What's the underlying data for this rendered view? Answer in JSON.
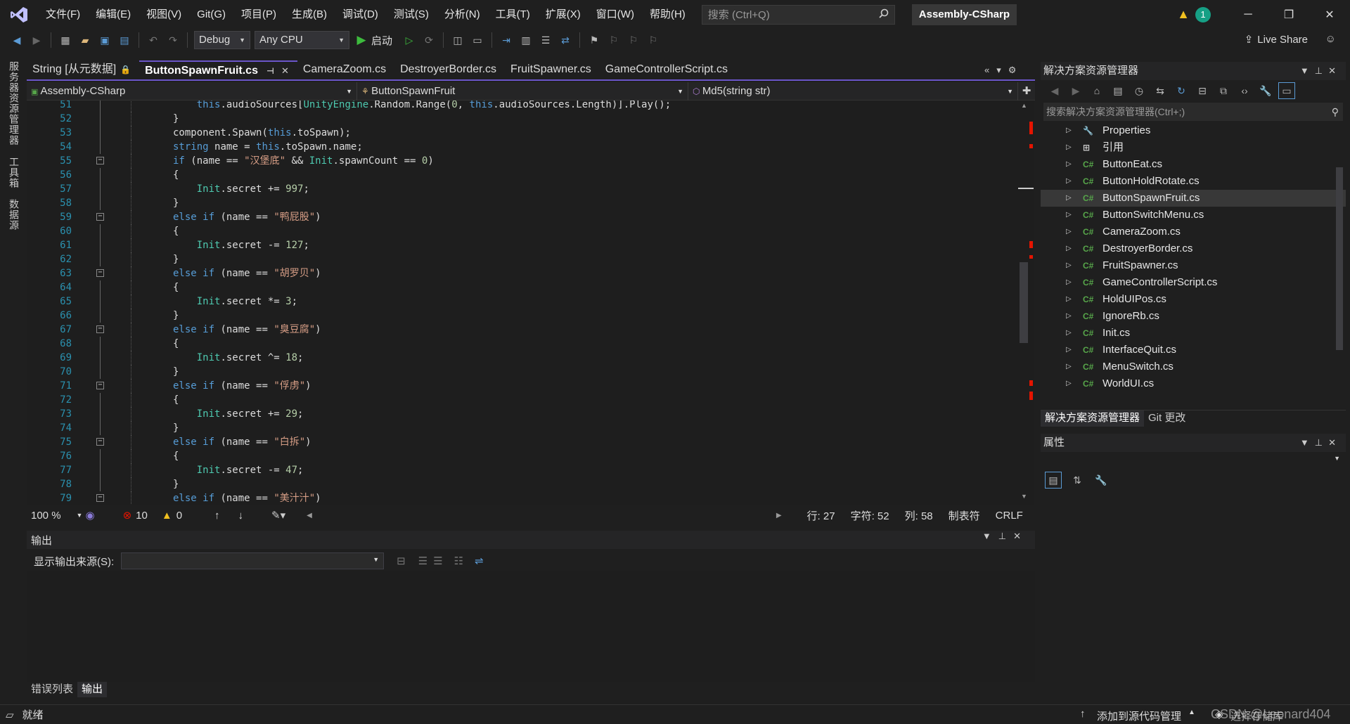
{
  "titlebar": {
    "menus": [
      "文件(F)",
      "编辑(E)",
      "视图(V)",
      "Git(G)",
      "项目(P)",
      "生成(B)",
      "调试(D)",
      "测试(S)",
      "分析(N)",
      "工具(T)",
      "扩展(X)",
      "窗口(W)",
      "帮助(H)"
    ],
    "search_placeholder": "搜索 (Ctrl+Q)",
    "solution_name": "Assembly-CSharp",
    "notification_count": "1"
  },
  "toolbar": {
    "config": "Debug",
    "platform": "Any CPU",
    "start_label": "启动",
    "live_share": "Live Share"
  },
  "left_strip": [
    "服务器资源管理器",
    "工具箱",
    "数据源"
  ],
  "editor": {
    "tabs": [
      {
        "label": "String [从元数据]",
        "active": false
      },
      {
        "label": "ButtonSpawnFruit.cs",
        "active": true
      },
      {
        "label": "CameraZoom.cs",
        "active": false
      },
      {
        "label": "DestroyerBorder.cs",
        "active": false
      },
      {
        "label": "FruitSpawner.cs",
        "active": false
      },
      {
        "label": "GameControllerScript.cs",
        "active": false
      }
    ],
    "nav_project": "Assembly-CSharp",
    "nav_class": "ButtonSpawnFruit",
    "nav_member": "Md5(string str)",
    "lines": [
      {
        "n": "51",
        "code": "    this.audioSources[UnityEngine.Random.Range(0, this.audioSources.Length)].Play();"
      },
      {
        "n": "52",
        "code": "}"
      },
      {
        "n": "53",
        "code": "component.Spawn(this.toSpawn);"
      },
      {
        "n": "54",
        "code": "string name = this.toSpawn.name;"
      },
      {
        "n": "55",
        "code": "if (name == \"汉堡底\" && Init.spawnCount == 0)"
      },
      {
        "n": "56",
        "code": "{"
      },
      {
        "n": "57",
        "code": "    Init.secret += 997;"
      },
      {
        "n": "58",
        "code": "}"
      },
      {
        "n": "59",
        "code": "else if (name == \"鸭屁股\")"
      },
      {
        "n": "60",
        "code": "{"
      },
      {
        "n": "61",
        "code": "    Init.secret -= 127;"
      },
      {
        "n": "62",
        "code": "}"
      },
      {
        "n": "63",
        "code": "else if (name == \"胡罗贝\")"
      },
      {
        "n": "64",
        "code": "{"
      },
      {
        "n": "65",
        "code": "    Init.secret *= 3;"
      },
      {
        "n": "66",
        "code": "}"
      },
      {
        "n": "67",
        "code": "else if (name == \"臭豆腐\")"
      },
      {
        "n": "68",
        "code": "{"
      },
      {
        "n": "69",
        "code": "    Init.secret ^= 18;"
      },
      {
        "n": "70",
        "code": "}"
      },
      {
        "n": "71",
        "code": "else if (name == \"俘虏\")"
      },
      {
        "n": "72",
        "code": "{"
      },
      {
        "n": "73",
        "code": "    Init.secret += 29;"
      },
      {
        "n": "74",
        "code": "}"
      },
      {
        "n": "75",
        "code": "else if (name == \"白拆\")"
      },
      {
        "n": "76",
        "code": "{"
      },
      {
        "n": "77",
        "code": "    Init.secret -= 47;"
      },
      {
        "n": "78",
        "code": "}"
      },
      {
        "n": "79",
        "code": "else if (name == \"美汁汁\")"
      }
    ],
    "zoom": "100 %",
    "errors": "10",
    "warnings": "0",
    "row": "行: 27",
    "char": "字符: 52",
    "col": "列: 58",
    "indent": "制表符",
    "eol": "CRLF"
  },
  "output": {
    "title": "输出",
    "source_label": "显示输出来源(S):",
    "bottom_tabs": [
      "错误列表",
      "输出"
    ]
  },
  "solution_explorer": {
    "title": "解决方案资源管理器",
    "search_placeholder": "搜索解决方案资源管理器(Ctrl+;)",
    "items": [
      {
        "label": "Properties",
        "icon": "wrench-icon",
        "selected": false
      },
      {
        "label": "引用",
        "icon": "references-icon",
        "selected": false
      },
      {
        "label": "ButtonEat.cs",
        "icon": "csharp-icon",
        "selected": false
      },
      {
        "label": "ButtonHoldRotate.cs",
        "icon": "csharp-icon",
        "selected": false
      },
      {
        "label": "ButtonSpawnFruit.cs",
        "icon": "csharp-icon",
        "selected": true
      },
      {
        "label": "ButtonSwitchMenu.cs",
        "icon": "csharp-icon",
        "selected": false
      },
      {
        "label": "CameraZoom.cs",
        "icon": "csharp-icon",
        "selected": false
      },
      {
        "label": "DestroyerBorder.cs",
        "icon": "csharp-icon",
        "selected": false
      },
      {
        "label": "FruitSpawner.cs",
        "icon": "csharp-icon",
        "selected": false
      },
      {
        "label": "GameControllerScript.cs",
        "icon": "csharp-icon",
        "selected": false
      },
      {
        "label": "HoldUIPos.cs",
        "icon": "csharp-icon",
        "selected": false
      },
      {
        "label": "IgnoreRb.cs",
        "icon": "csharp-icon",
        "selected": false
      },
      {
        "label": "Init.cs",
        "icon": "csharp-icon",
        "selected": false
      },
      {
        "label": "InterfaceQuit.cs",
        "icon": "csharp-icon",
        "selected": false
      },
      {
        "label": "MenuSwitch.cs",
        "icon": "csharp-icon",
        "selected": false
      },
      {
        "label": "WorldUI.cs",
        "icon": "csharp-icon",
        "selected": false
      }
    ],
    "tabs": [
      "解决方案资源管理器",
      "Git 更改"
    ]
  },
  "properties": {
    "title": "属性"
  },
  "statusbar": {
    "ready": "就绪",
    "add_source": "添加到源代码管理",
    "select_repo": "选择存储库",
    "watermark": "CSDN @Leonard404"
  },
  "colors": {
    "accent": "#6a55c8",
    "error": "#e51400",
    "background": "#1f1f1f"
  }
}
